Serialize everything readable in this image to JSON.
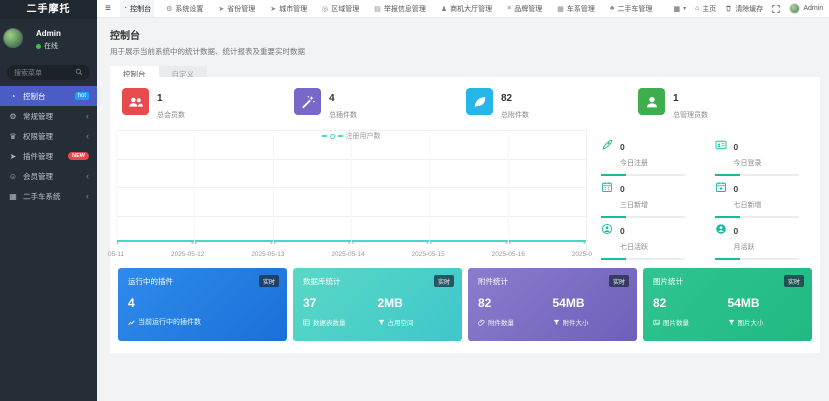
{
  "app": {
    "name": "二手摩托"
  },
  "topnav": {
    "items": [
      {
        "label": "控制台",
        "icon": "dashboard-icon",
        "active": true
      },
      {
        "label": "系统设置",
        "icon": "gears-icon"
      },
      {
        "label": "省份管理",
        "icon": "location-arrow-icon"
      },
      {
        "label": "城市管理",
        "icon": "location-arrow-icon"
      },
      {
        "label": "区域管理",
        "icon": "circle-o-icon"
      },
      {
        "label": "举报信息管理",
        "icon": "report-icon"
      },
      {
        "label": "商机大厅管理",
        "icon": "user-icon"
      },
      {
        "label": "品牌管理",
        "icon": "list-icon"
      },
      {
        "label": "车系管理",
        "icon": "th-large-icon"
      },
      {
        "label": "二手车管理",
        "icon": "sitemap-icon"
      }
    ],
    "right": {
      "home_label": "主页",
      "clear_cache_label": "清除缓存",
      "username": "Admin"
    }
  },
  "sidebar": {
    "user": {
      "name": "Admin",
      "status": "在线"
    },
    "search_placeholder": "搜索菜单",
    "items": [
      {
        "label": "控制台",
        "icon": "dashboard-icon",
        "badge": "hot",
        "active": true
      },
      {
        "label": "常规管理",
        "icon": "gear-icon"
      },
      {
        "label": "权限管理",
        "icon": "group-icon"
      },
      {
        "label": "插件管理",
        "icon": "rocket-icon",
        "badge": "NEW"
      },
      {
        "label": "会员管理",
        "icon": "user-icon"
      },
      {
        "label": "二手车系统",
        "icon": "th-icon"
      }
    ]
  },
  "page": {
    "title": "控制台",
    "subtitle": "用于展示当前系统中的统计数据、统计报表及重要实时数据",
    "tabs": [
      {
        "label": "控制台",
        "active": true
      },
      {
        "label": "自定义",
        "active": false
      }
    ]
  },
  "stats": [
    {
      "value": "1",
      "label": "总会员数",
      "icon": "users-icon",
      "color": "#e84b4b"
    },
    {
      "value": "4",
      "label": "总插件数",
      "icon": "magic-wand-icon",
      "color": "#7a68c8"
    },
    {
      "value": "82",
      "label": "总附件数",
      "icon": "leaf-icon",
      "color": "#27b6e9"
    },
    {
      "value": "1",
      "label": "总管理员数",
      "icon": "user-icon",
      "color": "#3fae4e"
    }
  ],
  "chart_data": {
    "type": "line",
    "series": [
      {
        "name": "注册用户数",
        "values": [
          0,
          0,
          0,
          0,
          0,
          0,
          0
        ]
      }
    ],
    "x": [
      "05-11",
      "2025-05-12",
      "2025-05-13",
      "2025-05-14",
      "2025-05-15",
      "2025-05-16",
      "2025-0"
    ],
    "ylim": [
      0,
      1
    ],
    "grid": true,
    "legend_position": "top-center",
    "line_color": "#4ed5c8"
  },
  "mini_stats": [
    {
      "value": "0",
      "label": "今日注册",
      "icon": "rocket-icon"
    },
    {
      "value": "0",
      "label": "今日登录",
      "icon": "id-card-icon"
    },
    {
      "value": "0",
      "label": "三日新增",
      "icon": "calendar-icon"
    },
    {
      "value": "0",
      "label": "七日新增",
      "icon": "calendar-plus-icon"
    },
    {
      "value": "0",
      "label": "七日活跃",
      "icon": "user-circle-icon"
    },
    {
      "value": "0",
      "label": "月活跃",
      "icon": "user-circle-filled-icon"
    }
  ],
  "panels": [
    {
      "title": "运行中的插件",
      "badge": "实时",
      "value": "4",
      "caption": "当前运行中的插件数",
      "caption_icon": "chart-up-icon",
      "colors": [
        "#2f8ceb",
        "#1b6fd8"
      ]
    },
    {
      "title": "数据库统计",
      "badge": "实时",
      "colors": [
        "#5ad8c5",
        "#3ec7cb"
      ],
      "metrics": [
        {
          "value": "37",
          "label": "数据表数量",
          "icon": "table-icon"
        },
        {
          "value": "2MB",
          "label": "占用空间",
          "icon": "filter-icon"
        }
      ]
    },
    {
      "title": "附件统计",
      "badge": "实时",
      "colors": [
        "#8b7cce",
        "#6e60b9"
      ],
      "metrics": [
        {
          "value": "82",
          "label": "附件数量",
          "icon": "paperclip-icon"
        },
        {
          "value": "54MB",
          "label": "附件大小",
          "icon": "filter-icon"
        }
      ]
    },
    {
      "title": "图片统计",
      "badge": "实时",
      "colors": [
        "#30c492",
        "#20ba81"
      ],
      "metrics": [
        {
          "value": "82",
          "label": "图片数量",
          "icon": "image-icon"
        },
        {
          "value": "54MB",
          "label": "图片大小",
          "icon": "filter-icon"
        }
      ]
    }
  ],
  "colors": {
    "sidebar_bg": "#252e36",
    "sidebar_active": "#4a5cc5",
    "hot_badge": "#1e9fff",
    "new_badge": "#e8474c",
    "teal_accent": "#18bc9c",
    "chart_line": "#4ed5c8",
    "page_bg": "#f1f3f4"
  }
}
